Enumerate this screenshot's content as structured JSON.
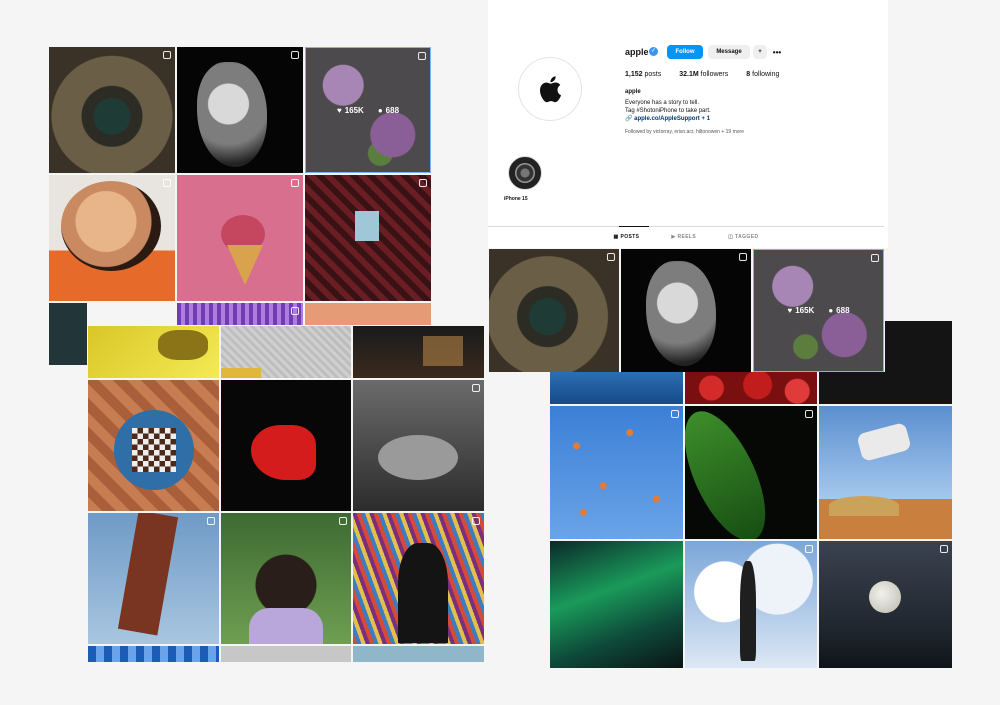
{
  "profile": {
    "username": "apple",
    "follow_label": "Follow",
    "message_label": "Message",
    "more_label": "•••",
    "posts_count": "1,152",
    "posts_label": "posts",
    "followers_count": "32.1M",
    "followers_label": "followers",
    "following_count": "8",
    "following_label": "following",
    "display_name": "apple",
    "bio_line1": "Everyone has a story to tell.",
    "bio_line2": "Tag #ShotoniPhone to take part.",
    "link": "apple.co/AppleSupport + 1",
    "followed_by": "Followed by victorray, erisn.acr, hiltonowen + 19 more",
    "highlight_label": "iPhone 15",
    "tabs": [
      "POSTS",
      "REELS",
      "TAGGED"
    ],
    "active_tab": "POSTS"
  },
  "hover_stats": {
    "likes": "165K",
    "comments": "688"
  },
  "colors": {
    "follow_button": "#0095f6",
    "verified_badge": "#3897f0",
    "tile_highlight_border": "#7fb0ff"
  }
}
